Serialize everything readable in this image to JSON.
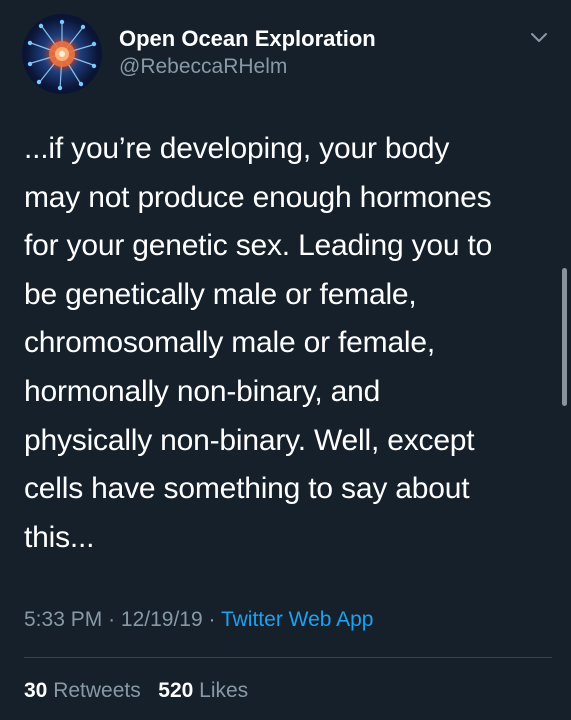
{
  "tweet": {
    "author": {
      "display_name": "Open Ocean Exploration",
      "handle": "@RebeccaRHelm",
      "avatar_icon": "sea-creature-avatar"
    },
    "text": "...if you’re developing, your body\nmay not produce enough hormones\nfor your genetic sex. Leading you to\nbe genetically male or female,\nchromosomally male or female,\nhormonally non-binary, and\nphysically non-binary. Well, except\ncells have something to say about\nthis...",
    "time": "5:33 PM",
    "date": "12/19/19",
    "separator": "·",
    "source": "Twitter Web App",
    "retweet_count": "30",
    "retweets_label": "Retweets",
    "like_count": "520",
    "likes_label": "Likes"
  },
  "colors": {
    "background": "#15202b",
    "primary_text": "#ffffff",
    "secondary_text": "#8899a6",
    "link": "#1da1f2",
    "divider": "#38444d"
  }
}
